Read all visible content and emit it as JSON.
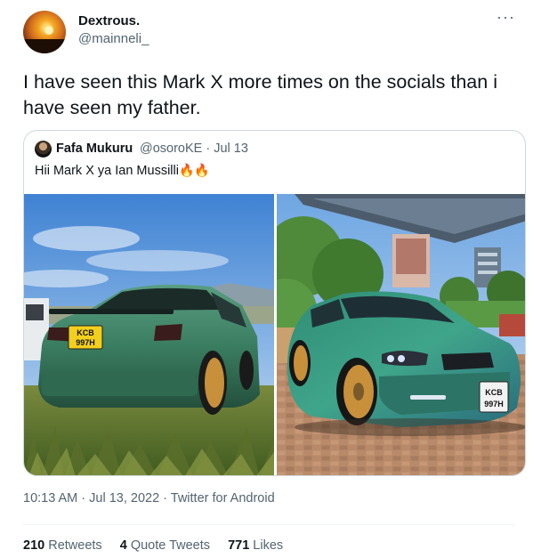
{
  "author": {
    "name": "Dextrous.",
    "handle": "@mainneli_"
  },
  "more_glyph": "···",
  "tweet_text": "I have seen this Mark X more times on the socials than i have seen my father.",
  "quoted": {
    "name": "Fafa Mukuru",
    "handle_date": "@osoroKE · Jul 13",
    "text": "Hii Mark X ya Ian Mussilli",
    "emoji": "🔥🔥",
    "plate_left": [
      "KCB",
      "997H"
    ],
    "plate_right": [
      "KCB",
      "997H"
    ]
  },
  "timestamp": "10:13 AM · Jul 13, 2022 · Twitter for Android",
  "stats": {
    "retweets_count": "210",
    "retweets_label": "Retweets",
    "quotes_count": "4",
    "quotes_label": "Quote Tweets",
    "likes_count": "771",
    "likes_label": "Likes"
  },
  "colors": {
    "car_green": "#3f8a6a",
    "wheel_gold": "#c8903a",
    "plate_yellow": "#f2cf1d",
    "sky_blue": "#4f8fd6"
  }
}
